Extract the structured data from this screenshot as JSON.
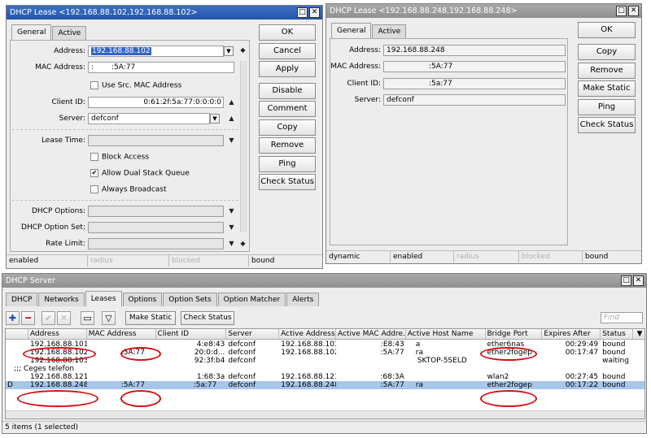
{
  "lease1": {
    "title": "DHCP Lease <192.168.88.102,192.168.88.102>",
    "tab_general": "General",
    "tab_active": "Active",
    "address_label": "Address:",
    "address_value": "192.168.88.102",
    "mac_label": "MAC Address:",
    "mac_prefix": ":",
    "mac_suffix": ":5A:77",
    "use_src_mac": "Use Src. MAC Address",
    "client_id_label": "Client ID:",
    "client_id_value": "0:61:2f:5a:77:0:0:0:0",
    "server_label": "Server:",
    "server_value": "defconf",
    "lease_time_label": "Lease Time:",
    "block_access": "Block Access",
    "allow_dual": "Allow Dual Stack Queue",
    "always_broadcast": "Always Broadcast",
    "dhcp_options_label": "DHCP Options:",
    "dhcp_option_set_label": "DHCP Option Set:",
    "rate_limit_label": "Rate Limit:",
    "buttons": [
      "OK",
      "Cancel",
      "Apply",
      "Disable",
      "Comment",
      "Copy",
      "Remove",
      "Ping",
      "Check Status"
    ],
    "status": [
      "enabled",
      "radius",
      "blocked",
      "bound"
    ]
  },
  "lease2": {
    "title": "DHCP Lease <192.168.88.248,192.168.88.248>",
    "tab_general": "General",
    "tab_active": "Active",
    "address_label": "Address:",
    "address_value": "192.168.88.248",
    "mac_label": "MAC Address:",
    "mac_suffix": ":5A:77",
    "client_id_label": "Client ID:",
    "client_id_suffix": ":5a:77",
    "server_label": "Server:",
    "server_value": "defconf",
    "buttons": [
      "OK",
      "Copy",
      "Remove",
      "Make Static",
      "Ping",
      "Check Status"
    ],
    "status": [
      "dynamic",
      "enabled",
      "radius",
      "blocked",
      "bound"
    ]
  },
  "server": {
    "title": "DHCP Server",
    "tabs": [
      "DHCP",
      "Networks",
      "Leases",
      "Options",
      "Option Sets",
      "Option Matcher",
      "Alerts"
    ],
    "selected_tab": "Leases",
    "make_static": "Make Static",
    "check_status": "Check Status",
    "find_placeholder": "Find",
    "columns": [
      "Address",
      "MAC Address",
      "Client ID",
      "Server",
      "Active Address",
      "Active MAC Addre...",
      "Active Host Name",
      "Bridge Port",
      "Expires After",
      "Status"
    ],
    "rows": [
      {
        "flag": "",
        "address": "192.168.88.101",
        "mac": "",
        "client": "4:e8:43",
        "server": "defconf",
        "active_addr": "192.168.88.101",
        "active_mac": ":E8:43",
        "host": "a",
        "port": "ether6nas",
        "expires": "00:29:49",
        "status": "bound"
      },
      {
        "flag": "",
        "address": "192.168.88.102",
        "mac": ":5A:77",
        "client": "20:0:d...",
        "server": "defconf",
        "active_addr": "192.168.88.102",
        "active_mac": ":5A:77",
        "host": "ra",
        "port": "ether2fogep",
        "expires": "00:17:47",
        "status": "bound"
      },
      {
        "flag": "",
        "address": "192.168.88.103",
        "mac": "",
        "client": "92:3f:b4",
        "server": "defconf",
        "active_addr": "",
        "active_mac": "",
        "host": "SKTOP-5SELD",
        "port": "",
        "expires": "",
        "status": "waiting"
      },
      {
        "group": ";;; Ceges telefon"
      },
      {
        "flag": "",
        "address": "192.168.88.121",
        "mac": "",
        "client": "1:68:3a",
        "server": "defconf",
        "active_addr": "192.168.88.121",
        "active_mac": ":68:3A",
        "host": "",
        "port": "wlan2",
        "expires": "00:27:45",
        "status": "bound"
      },
      {
        "flag": "D",
        "address": "192.168.88.248",
        "mac": ":5A:77",
        "client": ":5a:77",
        "server": "defconf",
        "active_addr": "192.168.88.248",
        "active_mac": ":5A:77",
        "host": "ra",
        "port": "ether2fogep",
        "expires": "00:17:22",
        "status": "bound",
        "selected": true
      }
    ],
    "footer": "5 items (1 selected)"
  },
  "colors": {
    "title_active": "#2456ab",
    "title_inactive": "#909090",
    "selection": "#a7c6ec",
    "highlight_ring": "#d80f0f"
  }
}
